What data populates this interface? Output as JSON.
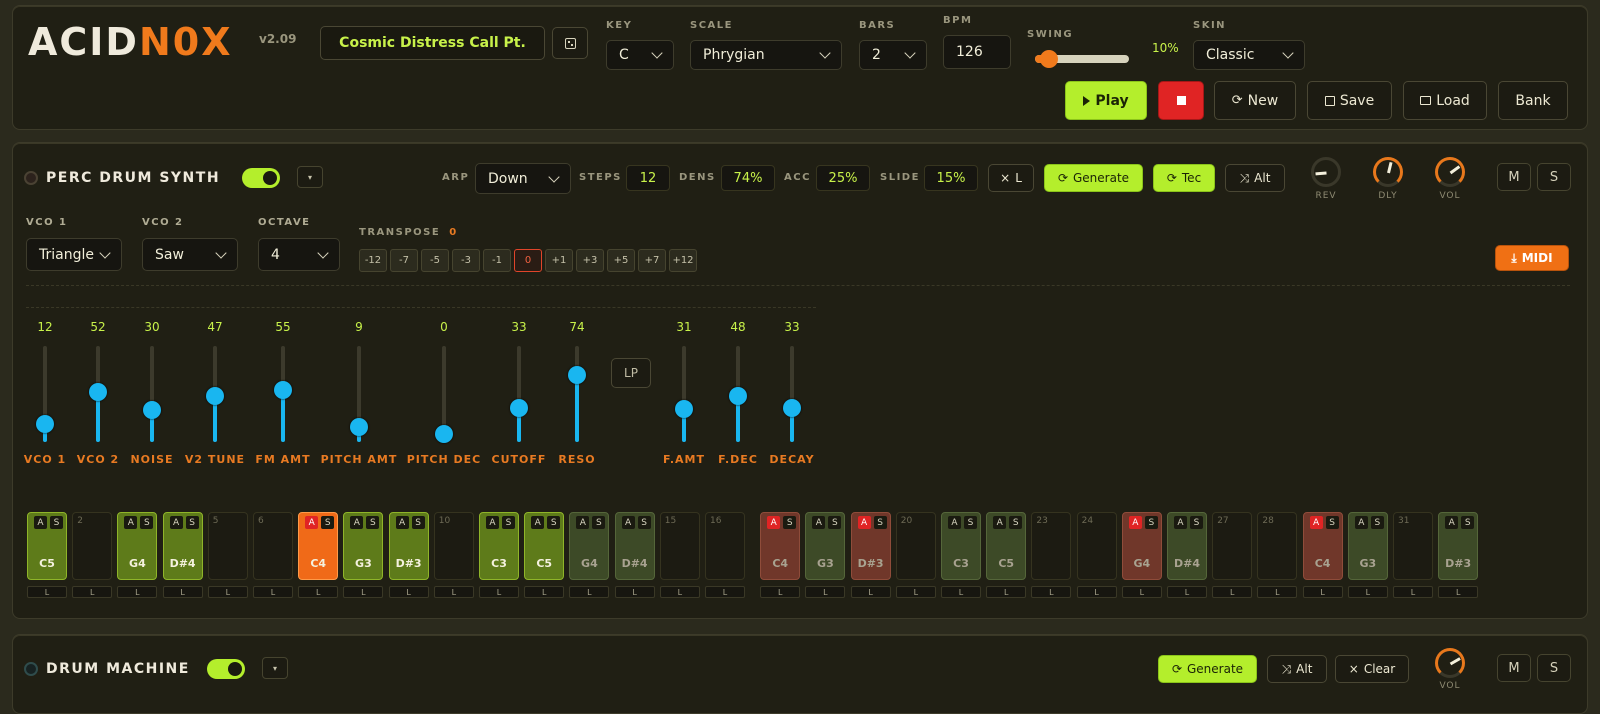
{
  "header": {
    "logo_a": "ACID",
    "logo_b": "N0X",
    "version": "v2.09",
    "pattern_name": "Cosmic Distress Call Pt.",
    "key_label": "KEY",
    "key_value": "C",
    "scale_label": "SCALE",
    "scale_value": "Phrygian",
    "bars_label": "BARS",
    "bars_value": "2",
    "bpm_label": "BPM",
    "bpm_value": "126",
    "swing_label": "SWING",
    "swing_value": "10%",
    "swing_fraction": 0.1,
    "skin_label": "SKIN",
    "skin_value": "Classic",
    "play_label": "Play",
    "new_label": "New",
    "save_label": "Save",
    "load_label": "Load",
    "bank_label": "Bank"
  },
  "synth": {
    "title": "PERC DRUM SYNTH",
    "arp_label": "ARP",
    "arp_value": "Down",
    "steps_label": "STEPS",
    "steps_value": "12",
    "dens_label": "DENS",
    "dens_value": "74%",
    "acc_label": "ACC",
    "acc_value": "25%",
    "slide_label": "SLIDE",
    "slide_value": "15%",
    "l_button": "L",
    "generate_label": "Generate",
    "tec_label": "Tec",
    "alt_label": "Alt",
    "knobs": [
      {
        "label": "REV",
        "value": 0.15,
        "color": "#3a382a"
      },
      {
        "label": "DLY",
        "value": 0.55,
        "color": "#e8781c"
      },
      {
        "label": "VOL",
        "value": 0.7,
        "color": "#e8781c"
      }
    ],
    "mute_label": "M",
    "solo_label": "S",
    "vco1_label": "VCO 1",
    "vco1_value": "Triangle",
    "vco2_label": "VCO 2",
    "vco2_value": "Saw",
    "octave_label": "OCTAVE",
    "octave_value": "4",
    "transpose_label": "TRANSPOSE",
    "transpose_value": "0",
    "transpose_options": [
      "-12",
      "-7",
      "-5",
      "-3",
      "-1",
      "0",
      "+1",
      "+3",
      "+5",
      "+7",
      "+12"
    ],
    "midi_label": "MIDI",
    "lp_label": "LP",
    "sliders": [
      {
        "name": "VCO 1",
        "value": "12",
        "level": 0.12
      },
      {
        "name": "VCO 2",
        "value": "52",
        "level": 0.52
      },
      {
        "name": "NOISE",
        "value": "30",
        "level": 0.3
      },
      {
        "name": "V2 TUNE",
        "value": "47",
        "level": 0.47
      },
      {
        "name": "FM AMT",
        "value": "55",
        "level": 0.55
      },
      {
        "name": "PITCH AMT",
        "value": "9",
        "level": 0.09
      },
      {
        "name": "PITCH DEC",
        "value": "0",
        "level": 0.0
      },
      {
        "name": "CUTOFF",
        "value": "33",
        "level": 0.33
      },
      {
        "name": "RESO",
        "value": "74",
        "level": 0.74
      },
      {
        "name": "F.AMT",
        "value": "31",
        "level": 0.31
      },
      {
        "name": "F.DEC",
        "value": "48",
        "level": 0.48
      },
      {
        "name": "DECAY",
        "value": "33",
        "level": 0.33
      }
    ],
    "steps": [
      {
        "type": "on",
        "note": "C5"
      },
      {
        "type": "empty",
        "num": "2"
      },
      {
        "type": "on",
        "note": "G4"
      },
      {
        "type": "on",
        "note": "D#4"
      },
      {
        "type": "empty",
        "num": "5"
      },
      {
        "type": "empty",
        "num": "6"
      },
      {
        "type": "acc",
        "note": "C4"
      },
      {
        "type": "on",
        "note": "G3"
      },
      {
        "type": "on",
        "note": "D#3"
      },
      {
        "type": "empty",
        "num": "10"
      },
      {
        "type": "on",
        "note": "C3"
      },
      {
        "type": "on",
        "note": "C5"
      },
      {
        "type": "dim",
        "note": "G4"
      },
      {
        "type": "dim",
        "note": "D#4"
      },
      {
        "type": "empty",
        "num": "15"
      },
      {
        "type": "empty",
        "num": "16"
      },
      {
        "type": "dimr",
        "note": "C4"
      },
      {
        "type": "dim",
        "note": "G3"
      },
      {
        "type": "dimr",
        "note": "D#3"
      },
      {
        "type": "empty",
        "num": "20"
      },
      {
        "type": "dim",
        "note": "C3"
      },
      {
        "type": "dim",
        "note": "C5"
      },
      {
        "type": "empty",
        "num": "23"
      },
      {
        "type": "empty",
        "num": "24"
      },
      {
        "type": "dimr",
        "note": "G4"
      },
      {
        "type": "dim",
        "note": "D#4"
      },
      {
        "type": "empty",
        "num": "27"
      },
      {
        "type": "empty",
        "num": "28"
      },
      {
        "type": "dimr",
        "note": "C4"
      },
      {
        "type": "dim",
        "note": "G3"
      },
      {
        "type": "empty",
        "num": "31"
      },
      {
        "type": "dim",
        "note": "D#3"
      }
    ],
    "step_a": "A",
    "step_s": "S",
    "step_l": "L"
  },
  "drum": {
    "title": "DRUM MACHINE",
    "generate_label": "Generate",
    "alt_label": "Alt",
    "clear_label": "Clear",
    "vol_label": "VOL",
    "mute_label": "M",
    "solo_label": "S"
  }
}
